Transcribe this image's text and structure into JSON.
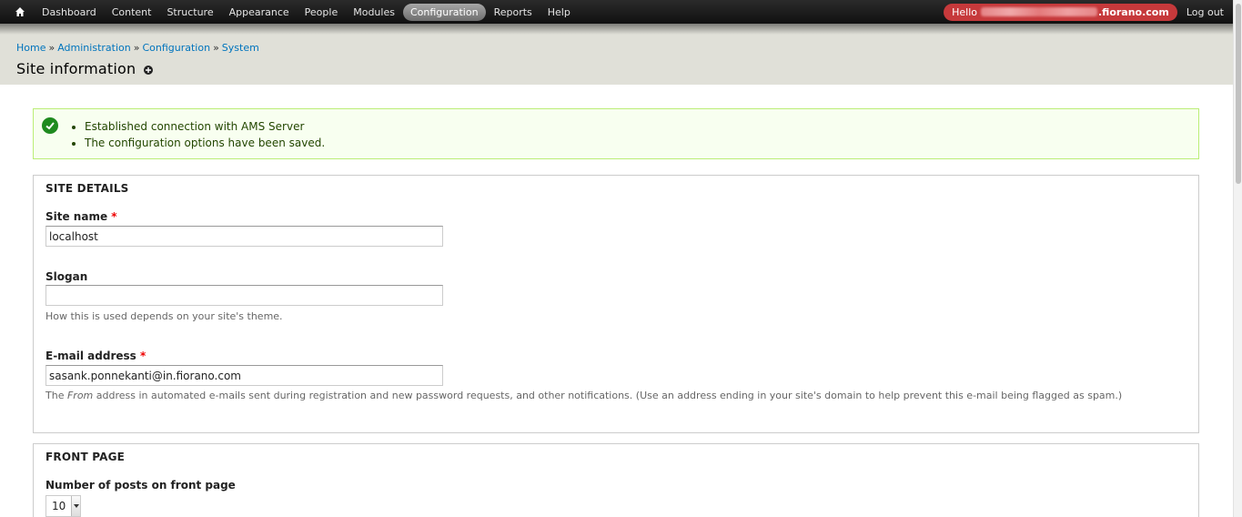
{
  "toolbar": {
    "items": [
      "Dashboard",
      "Content",
      "Structure",
      "Appearance",
      "People",
      "Modules",
      "Configuration",
      "Reports",
      "Help"
    ],
    "active": "Configuration",
    "hello_prefix": "Hello",
    "hello_domain": ".fiorano.com",
    "logout": "Log out"
  },
  "breadcrumb": {
    "items": [
      "Home",
      "Administration",
      "Configuration",
      "System"
    ],
    "separator": "»"
  },
  "page_title": "Site information",
  "status_messages": [
    "Established connection with AMS Server",
    "The configuration options have been saved."
  ],
  "site_details": {
    "legend": "SITE DETAILS",
    "site_name": {
      "label": "Site name",
      "required_mark": "*",
      "value": "localhost"
    },
    "slogan": {
      "label": "Slogan",
      "value": "",
      "description": "How this is used depends on your site's theme."
    },
    "email": {
      "label": "E-mail address",
      "required_mark": "*",
      "value": "sasank.ponnekanti@in.fiorano.com",
      "desc_prefix": "The ",
      "desc_em": "From",
      "desc_suffix": " address in automated e-mails sent during registration and new password requests, and other notifications. (Use an address ending in your site's domain to help prevent this e-mail being flagged as spam.)"
    }
  },
  "front_page": {
    "legend": "FRONT PAGE",
    "posts_label": "Number of posts on front page",
    "posts_value": "10"
  },
  "colors": {
    "toolbar": "#1f1f1f",
    "active_tab": "#8a8a8a",
    "hello_pill": "#c6393b",
    "header_bg": "#e0e0d8",
    "link": "#0074bd",
    "status_bg": "#f8fff0",
    "status_border": "#bbee77",
    "required": "#ee0000"
  }
}
